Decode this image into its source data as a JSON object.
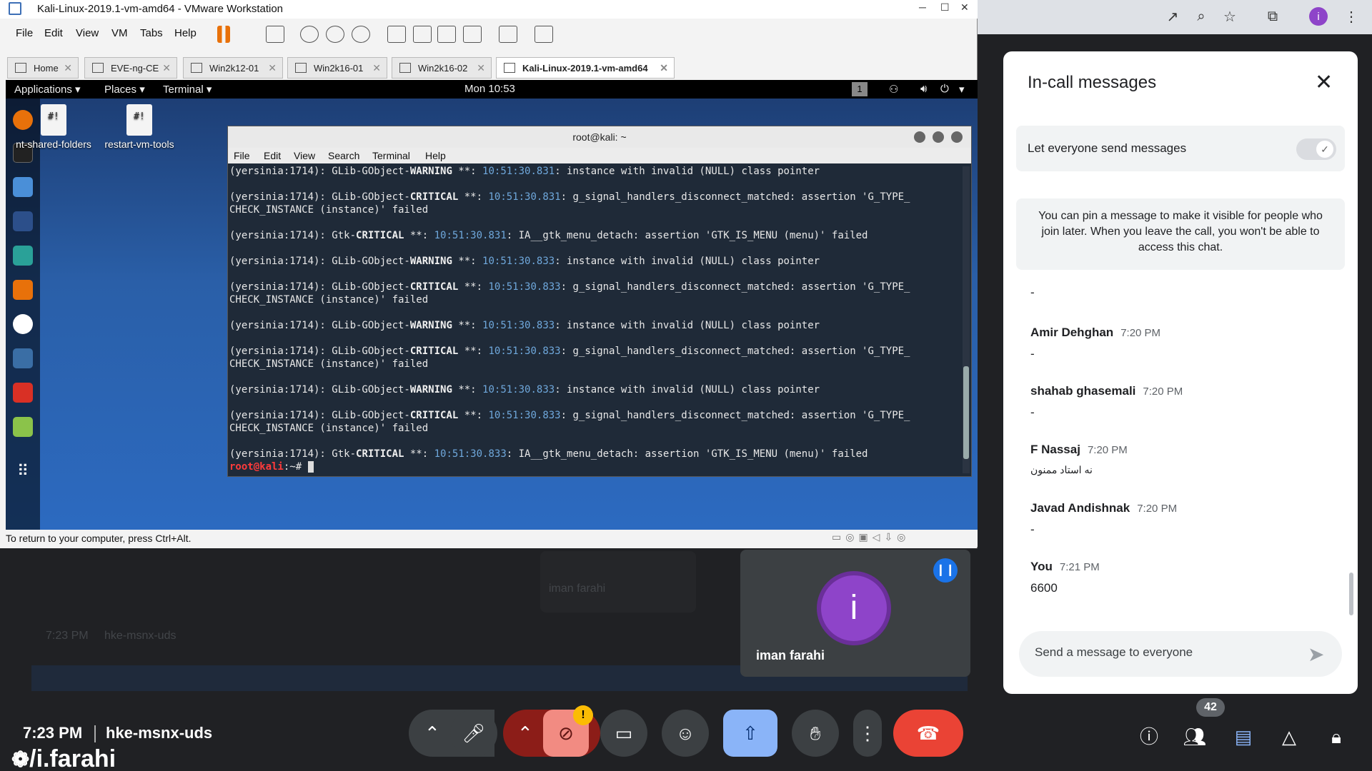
{
  "vmware": {
    "title": "Kali-Linux-2019.1-vm-amd64 - VMware Workstation",
    "menu": [
      "File",
      "Edit",
      "View",
      "VM",
      "Tabs",
      "Help"
    ],
    "tabs": [
      "Home",
      "EVE-ng-CE",
      "Win2k12-01",
      "Win2k16-01",
      "Win2k16-02",
      "Kali-Linux-2019.1-vm-amd64"
    ],
    "status": "To return to your computer, press Ctrl+Alt."
  },
  "kali": {
    "applications": "Applications ▾",
    "places": "Places ▾",
    "terminal_menu": "Terminal ▾",
    "clock": "Mon 10:53",
    "workspace": "1",
    "desktop_icons": [
      "nt-shared-folders",
      "restart-vm-tools"
    ],
    "desktop_doc_glyph": "#!"
  },
  "terminal": {
    "title": "root@kali: ~",
    "menu": [
      "File",
      "Edit",
      "View",
      "Search",
      "Terminal",
      "Help"
    ],
    "prompt_user": "root@kali",
    "prompt_rest": ":~# "
  },
  "meet": {
    "tile_name": "iman farahi",
    "avatar_letter": "i",
    "time": "7:23 PM",
    "code": "hke-msnx-uds",
    "watermark": "/i.farahi",
    "participants_count": "42",
    "cam_warning": "!"
  },
  "ghost": {
    "tile_name": "iman farahi",
    "time": "7:23 PM",
    "code": "hke-msnx-uds"
  },
  "chat": {
    "title": "In-call messages",
    "toggle_label": "Let everyone send messages",
    "pin_info": "You can pin a message to make it visible for people who join later. When you leave the call, you won't be able to access this chat.",
    "top_dash": "-",
    "messages": [
      {
        "who": "Amir Dehghan",
        "time": "7:20 PM",
        "body": "-"
      },
      {
        "who": "shahab ghasemali",
        "time": "7:20 PM",
        "body": "-"
      },
      {
        "who": "F Nassaj",
        "time": "7:20 PM",
        "body": "نه استاد ممنون"
      },
      {
        "who": "Javad Andishnak",
        "time": "7:20 PM",
        "body": "-"
      },
      {
        "who": "You",
        "time": "7:21 PM",
        "body": "6600"
      }
    ],
    "input_placeholder": "Send a message to everyone"
  },
  "colors": {
    "hangup": "#ea4335",
    "share_active": "#8ab4f8",
    "cam_off": "#f28b82",
    "kali_prompt": "#ff3b3b"
  }
}
